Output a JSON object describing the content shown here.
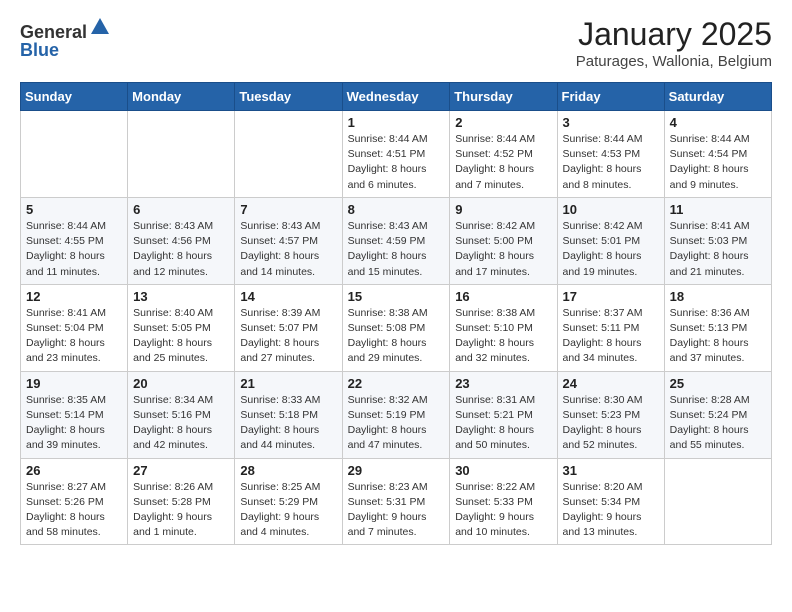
{
  "logo": {
    "general": "General",
    "blue": "Blue"
  },
  "header": {
    "month": "January 2025",
    "location": "Paturages, Wallonia, Belgium"
  },
  "weekdays": [
    "Sunday",
    "Monday",
    "Tuesday",
    "Wednesday",
    "Thursday",
    "Friday",
    "Saturday"
  ],
  "weeks": [
    [
      {
        "day": "",
        "info": ""
      },
      {
        "day": "",
        "info": ""
      },
      {
        "day": "",
        "info": ""
      },
      {
        "day": "1",
        "info": "Sunrise: 8:44 AM\nSunset: 4:51 PM\nDaylight: 8 hours and 6 minutes."
      },
      {
        "day": "2",
        "info": "Sunrise: 8:44 AM\nSunset: 4:52 PM\nDaylight: 8 hours and 7 minutes."
      },
      {
        "day": "3",
        "info": "Sunrise: 8:44 AM\nSunset: 4:53 PM\nDaylight: 8 hours and 8 minutes."
      },
      {
        "day": "4",
        "info": "Sunrise: 8:44 AM\nSunset: 4:54 PM\nDaylight: 8 hours and 9 minutes."
      }
    ],
    [
      {
        "day": "5",
        "info": "Sunrise: 8:44 AM\nSunset: 4:55 PM\nDaylight: 8 hours and 11 minutes."
      },
      {
        "day": "6",
        "info": "Sunrise: 8:43 AM\nSunset: 4:56 PM\nDaylight: 8 hours and 12 minutes."
      },
      {
        "day": "7",
        "info": "Sunrise: 8:43 AM\nSunset: 4:57 PM\nDaylight: 8 hours and 14 minutes."
      },
      {
        "day": "8",
        "info": "Sunrise: 8:43 AM\nSunset: 4:59 PM\nDaylight: 8 hours and 15 minutes."
      },
      {
        "day": "9",
        "info": "Sunrise: 8:42 AM\nSunset: 5:00 PM\nDaylight: 8 hours and 17 minutes."
      },
      {
        "day": "10",
        "info": "Sunrise: 8:42 AM\nSunset: 5:01 PM\nDaylight: 8 hours and 19 minutes."
      },
      {
        "day": "11",
        "info": "Sunrise: 8:41 AM\nSunset: 5:03 PM\nDaylight: 8 hours and 21 minutes."
      }
    ],
    [
      {
        "day": "12",
        "info": "Sunrise: 8:41 AM\nSunset: 5:04 PM\nDaylight: 8 hours and 23 minutes."
      },
      {
        "day": "13",
        "info": "Sunrise: 8:40 AM\nSunset: 5:05 PM\nDaylight: 8 hours and 25 minutes."
      },
      {
        "day": "14",
        "info": "Sunrise: 8:39 AM\nSunset: 5:07 PM\nDaylight: 8 hours and 27 minutes."
      },
      {
        "day": "15",
        "info": "Sunrise: 8:38 AM\nSunset: 5:08 PM\nDaylight: 8 hours and 29 minutes."
      },
      {
        "day": "16",
        "info": "Sunrise: 8:38 AM\nSunset: 5:10 PM\nDaylight: 8 hours and 32 minutes."
      },
      {
        "day": "17",
        "info": "Sunrise: 8:37 AM\nSunset: 5:11 PM\nDaylight: 8 hours and 34 minutes."
      },
      {
        "day": "18",
        "info": "Sunrise: 8:36 AM\nSunset: 5:13 PM\nDaylight: 8 hours and 37 minutes."
      }
    ],
    [
      {
        "day": "19",
        "info": "Sunrise: 8:35 AM\nSunset: 5:14 PM\nDaylight: 8 hours and 39 minutes."
      },
      {
        "day": "20",
        "info": "Sunrise: 8:34 AM\nSunset: 5:16 PM\nDaylight: 8 hours and 42 minutes."
      },
      {
        "day": "21",
        "info": "Sunrise: 8:33 AM\nSunset: 5:18 PM\nDaylight: 8 hours and 44 minutes."
      },
      {
        "day": "22",
        "info": "Sunrise: 8:32 AM\nSunset: 5:19 PM\nDaylight: 8 hours and 47 minutes."
      },
      {
        "day": "23",
        "info": "Sunrise: 8:31 AM\nSunset: 5:21 PM\nDaylight: 8 hours and 50 minutes."
      },
      {
        "day": "24",
        "info": "Sunrise: 8:30 AM\nSunset: 5:23 PM\nDaylight: 8 hours and 52 minutes."
      },
      {
        "day": "25",
        "info": "Sunrise: 8:28 AM\nSunset: 5:24 PM\nDaylight: 8 hours and 55 minutes."
      }
    ],
    [
      {
        "day": "26",
        "info": "Sunrise: 8:27 AM\nSunset: 5:26 PM\nDaylight: 8 hours and 58 minutes."
      },
      {
        "day": "27",
        "info": "Sunrise: 8:26 AM\nSunset: 5:28 PM\nDaylight: 9 hours and 1 minute."
      },
      {
        "day": "28",
        "info": "Sunrise: 8:25 AM\nSunset: 5:29 PM\nDaylight: 9 hours and 4 minutes."
      },
      {
        "day": "29",
        "info": "Sunrise: 8:23 AM\nSunset: 5:31 PM\nDaylight: 9 hours and 7 minutes."
      },
      {
        "day": "30",
        "info": "Sunrise: 8:22 AM\nSunset: 5:33 PM\nDaylight: 9 hours and 10 minutes."
      },
      {
        "day": "31",
        "info": "Sunrise: 8:20 AM\nSunset: 5:34 PM\nDaylight: 9 hours and 13 minutes."
      },
      {
        "day": "",
        "info": ""
      }
    ]
  ]
}
